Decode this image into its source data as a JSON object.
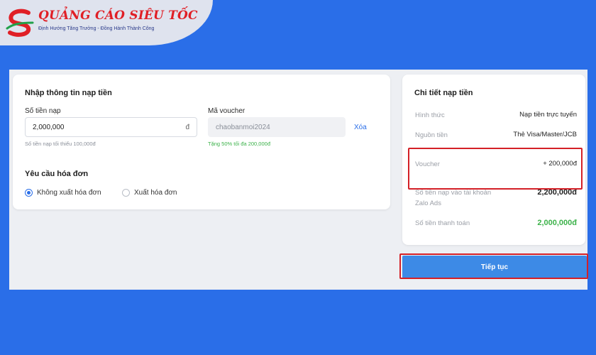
{
  "brand": {
    "title_part1": "QUẢNG CÁO ",
    "title_part2": "SIÊU TỐC",
    "tagline": "Định Hướng Tăng Trưởng - Đồng Hành Thành Công"
  },
  "form": {
    "title": "Nhập thông tin nạp tiền",
    "amount": {
      "label": "Số tiền nạp",
      "value": "2,000,000",
      "currency": "đ",
      "hint": "Số tiền nạp tối thiểu 100,000đ"
    },
    "voucher": {
      "label": "Mã voucher",
      "value": "chaobanmoi2024",
      "remove_label": "Xóa",
      "hint": "Tặng 50% tối đa 200,000đ"
    },
    "invoice": {
      "title": "Yêu cầu hóa đơn",
      "options": [
        {
          "label": "Không xuất hóa đơn",
          "selected": true
        },
        {
          "label": "Xuất hóa đơn",
          "selected": false
        }
      ]
    }
  },
  "details": {
    "title": "Chi tiết nạp tiền",
    "method_label": "Hình thức",
    "method_value": "Nạp tiền trực tuyến",
    "source_label": "Nguồn tiền",
    "source_value": "Thẻ Visa/Master/JCB",
    "voucher_label": "Voucher",
    "voucher_value": "+ 200,000đ",
    "deposit_label": "Số tiền nạp vào tài khoản Zalo Ads",
    "deposit_value": "2,200,000đ",
    "payment_label": "Số tiền thanh toán",
    "payment_value": "2,000,000đ"
  },
  "continue_button": "Tiếp tục",
  "colors": {
    "background": "#2a6ee8",
    "accent_blue": "#3d8ae6",
    "highlight_red": "#d42027",
    "success_green": "#3cb24a"
  }
}
